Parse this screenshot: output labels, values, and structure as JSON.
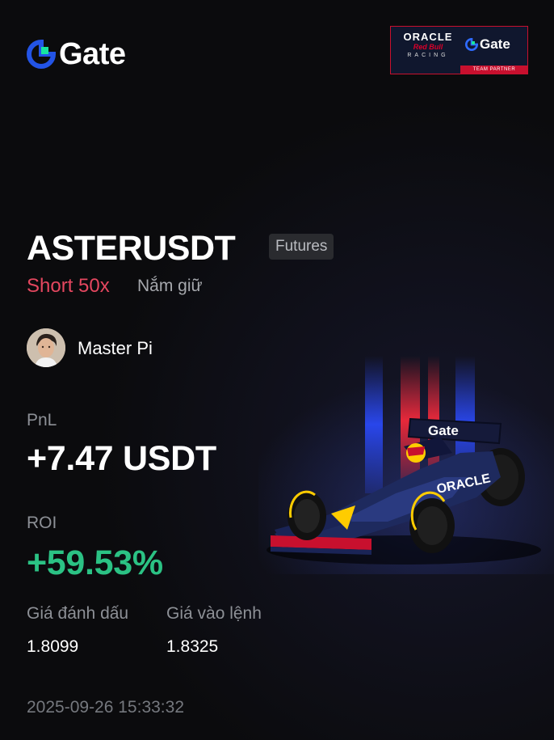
{
  "brand": {
    "name": "Gate"
  },
  "partner": {
    "oracle": "ORACLE",
    "redbull": "Red Bull",
    "racing": "RACING",
    "gate": "Gate",
    "strip": "TEAM PARTNER"
  },
  "position": {
    "symbol": "ASTERUSDT",
    "tag": "Futures",
    "side": "Short 50x",
    "status": "Nắm giữ"
  },
  "user": {
    "name": "Master Pi"
  },
  "stats": {
    "pnl_label": "PnL",
    "pnl_value": "+7.47 USDT",
    "roi_label": "ROI",
    "roi_value": "+59.53%",
    "mark_label": "Giá đánh dấu",
    "mark_value": "1.8099",
    "entry_label": "Giá vào lệnh",
    "entry_value": "1.8325"
  },
  "timestamp": "2025-09-26 15:33:32",
  "car_livery": {
    "wing_text": "Gate",
    "sidepod_text": "ORACLE"
  },
  "colors": {
    "background": "#0b0b0d",
    "short": "#e4475f",
    "roi": "#2bc284",
    "brand_blue": "#2354e6",
    "brand_green": "#17e5a0"
  },
  "icons": {
    "logo": "gate-logo-icon",
    "avatar": "user-avatar"
  }
}
